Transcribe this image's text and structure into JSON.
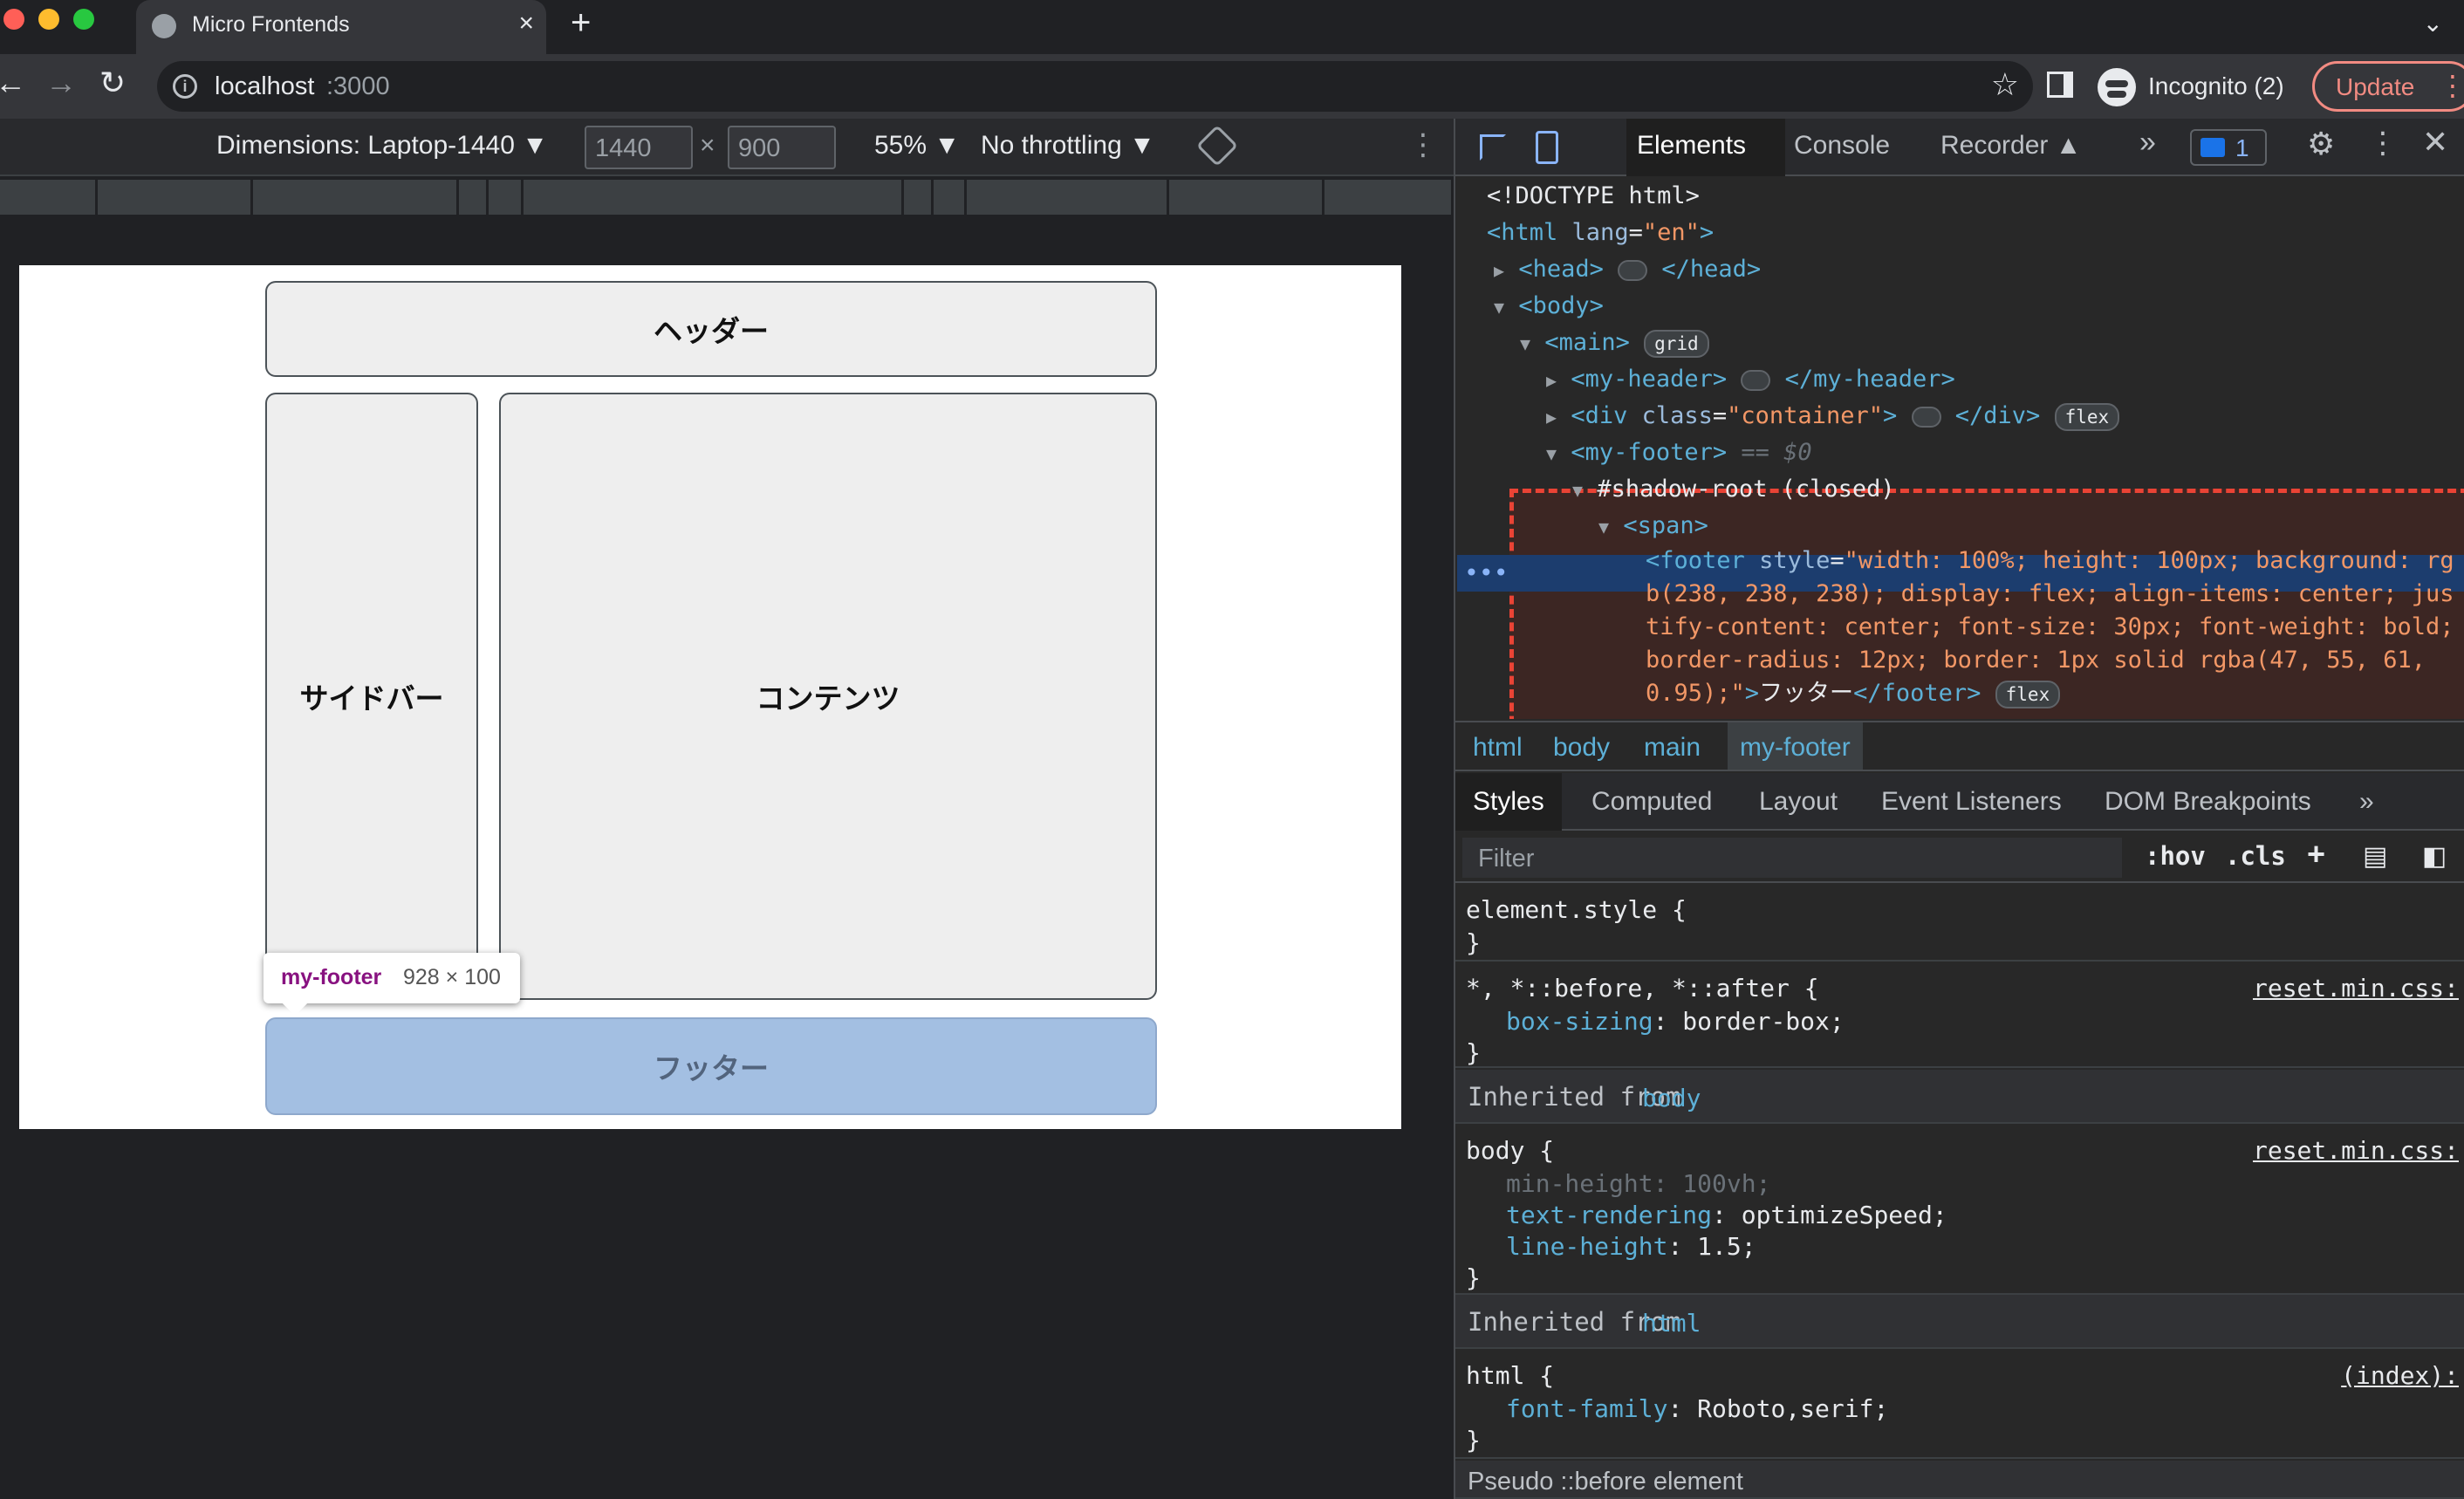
{
  "browser": {
    "tab_title": "Micro Frontends",
    "tab_close": "×",
    "new_tab": "+",
    "tab_menu": "⌄",
    "url_host": "localhost",
    "url_port": ":3000",
    "incognito_label": "Incognito (2)",
    "update_label": "Update",
    "nav_back": "←",
    "nav_forward": "→",
    "nav_reload": "↻",
    "star": "☆",
    "kebab": "⋮"
  },
  "device_toolbar": {
    "dimensions_label": "Dimensions: Laptop-1440 ▼",
    "width": "1440",
    "times": "×",
    "height": "900",
    "zoom": "55% ▼",
    "throttling": "No throttling ▼",
    "more": "⋮"
  },
  "page": {
    "header": "ヘッダー",
    "sidebar": "サイドバー",
    "content": "コンテンツ",
    "footer": "フッター",
    "tooltip_name": "my-footer",
    "tooltip_size": "928 × 100"
  },
  "devtools": {
    "tabs": [
      "Elements",
      "Console",
      "Recorder ▲"
    ],
    "more_tabs": "»",
    "issues_count": "1",
    "settings": "⚙",
    "kebab": "⋮",
    "close": "✕",
    "dom": {
      "doctype": "<!DOCTYPE html>",
      "html_open": "<html",
      "html_lang_attr": "lang",
      "html_lang_val": "\"en\"",
      "head": "<head>",
      "head_close": "</head>",
      "body": "<body>",
      "main": "<main>",
      "main_badge": "grid",
      "my_header": "<my-header>",
      "my_header_close": "</my-header>",
      "div_open": "<div",
      "div_class_attr": "class",
      "div_class_val": "\"container\"",
      "div_close": "</div>",
      "div_badge": "flex",
      "my_footer": "<my-footer>",
      "my_footer_suffix": "== $0",
      "shadow_root": "#shadow-root (closed)",
      "span": "<span>",
      "footer_open": "<footer",
      "footer_style_attr": "style",
      "footer_style_l1": "\"width: 100%; height: 100px; background: rg",
      "footer_style_l2": "b(238, 238, 238); display: flex; align-items: center; jus",
      "footer_style_l3": "tify-content: center; font-size: 30px; font-weight: bold;",
      "footer_style_l4": "border-radius: 12px; border: 1px solid rgba(47, 55, 61,",
      "footer_style_l5": "0.95);\"",
      "footer_text": "フッター",
      "footer_close": "</footer>",
      "footer_badge": "flex"
    },
    "breadcrumb": [
      "html",
      "body",
      "main",
      "my-footer"
    ],
    "sub_tabs": [
      "Styles",
      "Computed",
      "Layout",
      "Event Listeners",
      "DOM Breakpoints",
      "»"
    ],
    "filter_placeholder": "Filter",
    "filter_hov": ":hov",
    "filter_cls": ".cls",
    "filter_plus": "+",
    "styles": {
      "element_style_sel": "element.style {",
      "close_brace": "}",
      "universal_sel": "*, *::before, *::after {",
      "universal_src": "reset.min.css:",
      "box_sizing_name": "box-sizing",
      "box_sizing_val": "border-box;",
      "inherited_from": "Inherited from",
      "inh_body_tag": "body",
      "body_sel": "body {",
      "body_src": "reset.min.css:",
      "min_height_name": "min-height",
      "min_height_val": "100vh;",
      "text_rendering_name": "text-rendering",
      "text_rendering_val": "optimizeSpeed;",
      "line_height_name": "line-height",
      "line_height_val": "1.5;",
      "inh_html_tag": "html",
      "html_sel": "html {",
      "html_src": "(index):",
      "font_family_name": "font-family",
      "font_family_val": "Roboto,serif;",
      "pseudo_label": "Pseudo ::before element"
    }
  }
}
